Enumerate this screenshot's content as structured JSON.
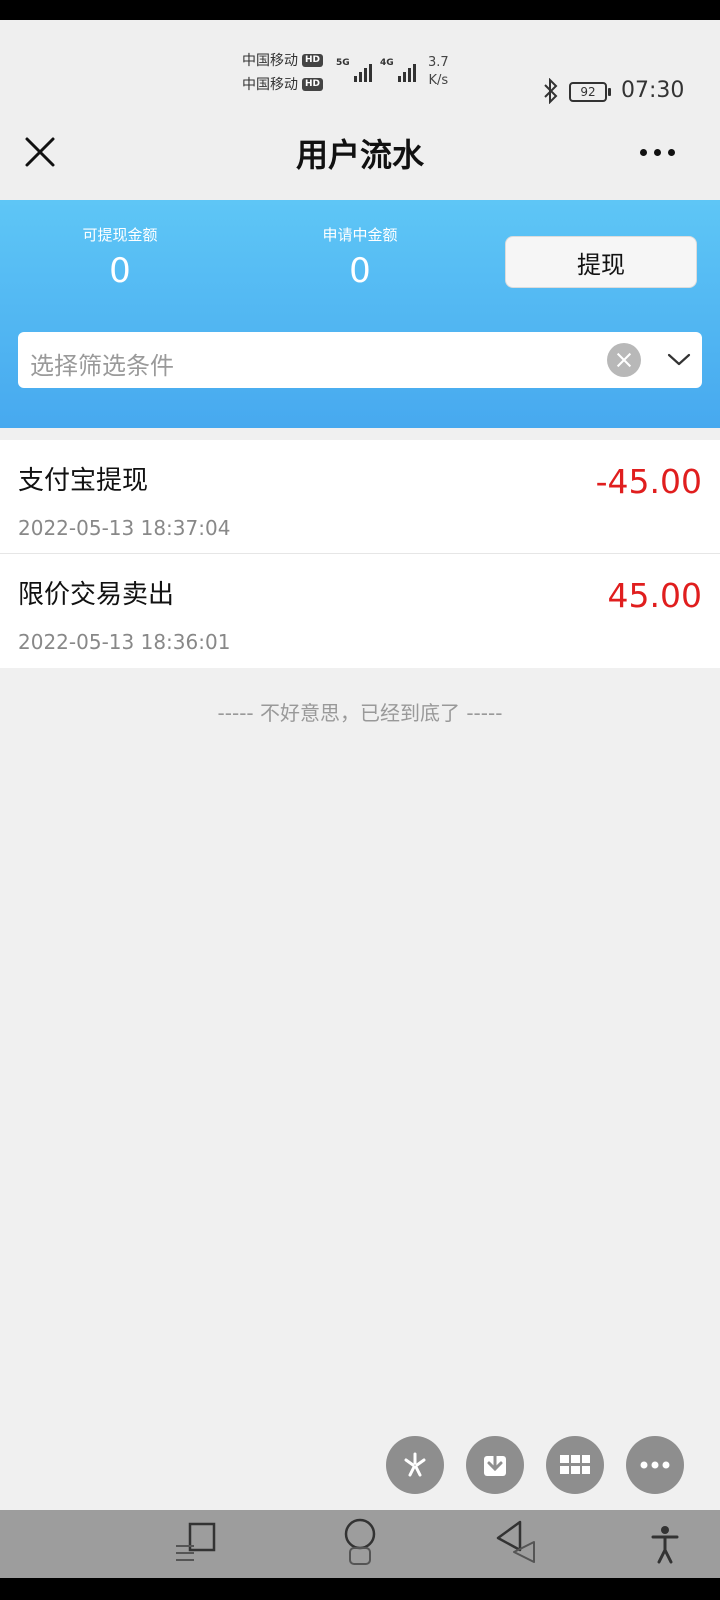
{
  "status_bar": {
    "carrier1": "中国移动",
    "carrier2": "中国移动",
    "hd_badge": "HD",
    "sim1_network": "5G",
    "sim2_network": "4G",
    "speed_value": "3.7",
    "speed_unit": "K/s",
    "battery": "92",
    "time": "07:30"
  },
  "header": {
    "title": "用户流水"
  },
  "summary": {
    "withdrawable_label": "可提现金额",
    "withdrawable_value": "0",
    "pending_label": "申请中金额",
    "pending_value": "0",
    "withdraw_button": "提现"
  },
  "filter": {
    "placeholder": "选择筛选条件"
  },
  "transactions": [
    {
      "title": "支付宝提现",
      "time": "2022-05-13 18:37:04",
      "amount": "-45.00"
    },
    {
      "title": "限价交易卖出",
      "time": "2022-05-13 18:36:01",
      "amount": "45.00"
    }
  ],
  "end_of_list": "----- 不好意思，已经到底了 -----",
  "colors": {
    "accent_blue": "#4aacef",
    "amount_red": "#e01e1e"
  }
}
